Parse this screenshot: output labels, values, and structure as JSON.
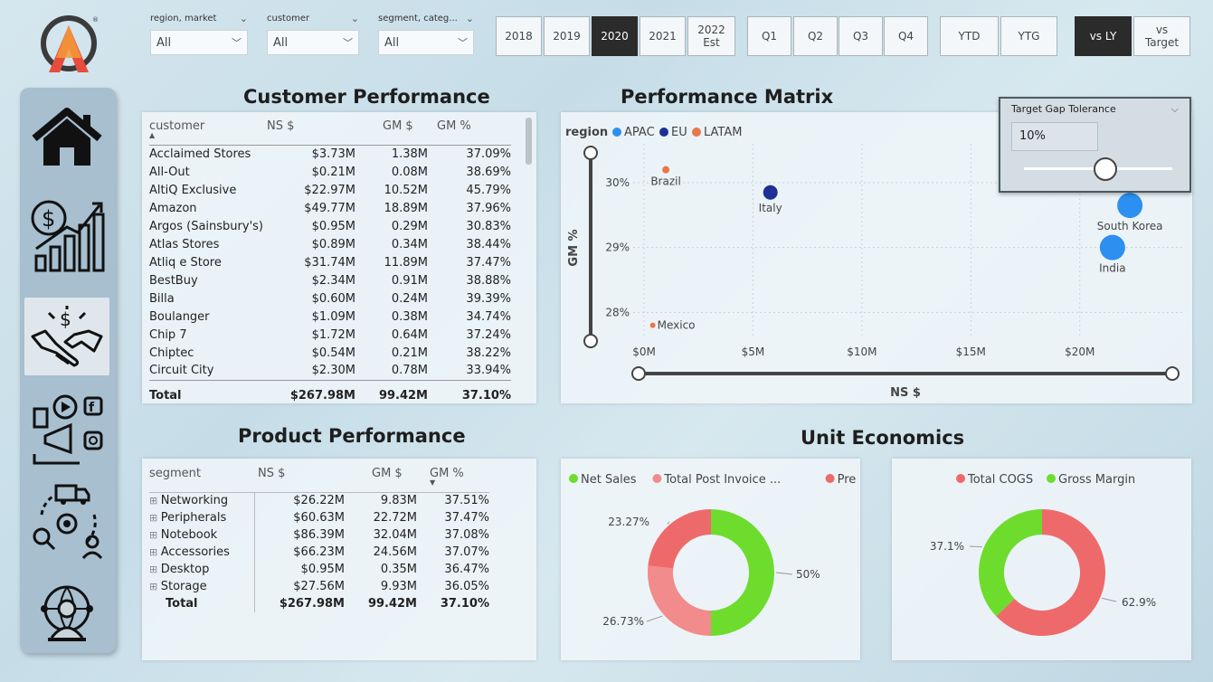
{
  "filters": {
    "region": {
      "label": "region, market",
      "value": "All"
    },
    "customer": {
      "label": "customer",
      "value": "All"
    },
    "segment": {
      "label": "segment, categ...",
      "value": "All"
    }
  },
  "years": [
    "2018",
    "2019",
    "2020",
    "2021",
    "2022 Est"
  ],
  "selected_year": "2020",
  "quarters": [
    "Q1",
    "Q2",
    "Q3",
    "Q4"
  ],
  "period": [
    "YTD",
    "YTG"
  ],
  "compare": [
    "vs LY",
    "vs Target"
  ],
  "selected_compare": "vs LY",
  "nav": [
    "home-icon",
    "finance-growth-icon",
    "sales-handshake-icon",
    "marketing-icon",
    "supply-chain-icon",
    "executive-icon"
  ],
  "customer_performance": {
    "title": "Customer Performance",
    "columns": [
      "customer",
      "NS $",
      "GM $",
      "GM %"
    ],
    "rows": [
      [
        "Acclaimed Stores",
        "$3.73M",
        "1.38M",
        "37.09%"
      ],
      [
        "All-Out",
        "$0.21M",
        "0.08M",
        "38.69%"
      ],
      [
        "AltiQ Exclusive",
        "$22.97M",
        "10.52M",
        "45.79%"
      ],
      [
        "Amazon",
        "$49.77M",
        "18.89M",
        "37.96%"
      ],
      [
        "Argos (Sainsbury's)",
        "$0.95M",
        "0.29M",
        "30.83%"
      ],
      [
        "Atlas Stores",
        "$0.89M",
        "0.34M",
        "38.44%"
      ],
      [
        "Atliq e Store",
        "$31.74M",
        "11.89M",
        "37.47%"
      ],
      [
        "BestBuy",
        "$2.34M",
        "0.91M",
        "38.88%"
      ],
      [
        "Billa",
        "$0.60M",
        "0.24M",
        "39.39%"
      ],
      [
        "Boulanger",
        "$1.09M",
        "0.38M",
        "34.74%"
      ],
      [
        "Chip 7",
        "$1.72M",
        "0.64M",
        "37.24%"
      ],
      [
        "Chiptec",
        "$0.54M",
        "0.21M",
        "38.22%"
      ],
      [
        "Circuit City",
        "$2.30M",
        "0.78M",
        "33.94%"
      ]
    ],
    "total": [
      "Total",
      "$267.98M",
      "99.42M",
      "37.10%"
    ]
  },
  "performance_matrix": {
    "title": "Performance Matrix",
    "legend_title": "region",
    "legend": [
      {
        "name": "APAC",
        "color": "#2d8ff0"
      },
      {
        "name": "EU",
        "color": "#1f2f96"
      },
      {
        "name": "LATAM",
        "color": "#e8764a"
      }
    ],
    "ylabel": "GM %",
    "xlabel": "NS $",
    "yticks": [
      "30%",
      "29%",
      "28%"
    ],
    "xticks": [
      "$0M",
      "$5M",
      "$10M",
      "$15M",
      "$20M"
    ]
  },
  "chart_data": [
    {
      "type": "scatter",
      "title": "Performance Matrix",
      "xlabel": "NS $",
      "ylabel": "GM %",
      "xlim": [
        0,
        23
      ],
      "ylim": [
        27.6,
        30.6
      ],
      "series": [
        {
          "name": "APAC",
          "color": "#2d8ff0",
          "points": [
            {
              "label": "South Korea",
              "x": 22.3,
              "y": 29.65,
              "size": 14
            },
            {
              "label": "India",
              "x": 21.5,
              "y": 29.0,
              "size": 14
            }
          ]
        },
        {
          "name": "EU",
          "color": "#1f2f96",
          "points": [
            {
              "label": "Italy",
              "x": 5.8,
              "y": 29.85,
              "size": 8
            }
          ]
        },
        {
          "name": "LATAM",
          "color": "#e8764a",
          "points": [
            {
              "label": "Brazil",
              "x": 1.0,
              "y": 30.2,
              "size": 4
            },
            {
              "label": "Mexico",
              "x": 0.4,
              "y": 27.8,
              "size": 3
            }
          ]
        }
      ]
    },
    {
      "type": "pie",
      "title": "Unit Economics",
      "legend": [
        "Net Sales",
        "Total Post Invoice ...",
        "Pre Invoice ..."
      ],
      "slices": [
        {
          "name": "Net Sales",
          "value": 50,
          "label": "50%",
          "color": "#6ddc2d"
        },
        {
          "name": "Total Post Invoice Deduction",
          "value": 26.73,
          "label": "26.73%",
          "color": "#f28b8b"
        },
        {
          "name": "Pre Invoice Deduction",
          "value": 23.27,
          "label": "23.27%",
          "color": "#ee6a6a"
        }
      ]
    },
    {
      "type": "pie",
      "legend": [
        "Total COGS",
        "Gross Margin"
      ],
      "slices": [
        {
          "name": "Total COGS",
          "value": 62.9,
          "label": "62.9%",
          "color": "#ee6a6a"
        },
        {
          "name": "Gross Margin",
          "value": 37.1,
          "label": "37.1%",
          "color": "#6ddc2d"
        }
      ]
    }
  ],
  "target_gap": {
    "title": "Target Gap Tolerance",
    "value": "10%",
    "fraction": 0.55
  },
  "product_performance": {
    "title": "Product Performance",
    "columns": [
      "segment",
      "NS $",
      "GM $",
      "GM %"
    ],
    "rows": [
      [
        "Networking",
        "$26.22M",
        "9.83M",
        "37.51%"
      ],
      [
        "Peripherals",
        "$60.63M",
        "22.72M",
        "37.47%"
      ],
      [
        "Notebook",
        "$86.39M",
        "32.04M",
        "37.08%"
      ],
      [
        "Accessories",
        "$66.23M",
        "24.56M",
        "37.07%"
      ],
      [
        "Desktop",
        "$0.95M",
        "0.35M",
        "36.47%"
      ],
      [
        "Storage",
        "$27.56M",
        "9.93M",
        "36.05%"
      ]
    ],
    "total": [
      "Total",
      "$267.98M",
      "99.42M",
      "37.10%"
    ]
  },
  "unit_economics": {
    "title": "Unit Economics",
    "donut1_legend": [
      {
        "name": "Net Sales",
        "color": "#6ddc2d"
      },
      {
        "name": "Total Post Invoice ...",
        "color": "#f28b8b"
      },
      {
        "name": "Pre Invoice ...",
        "color": "#ee6a6a"
      }
    ],
    "donut2_legend": [
      {
        "name": "Total COGS",
        "color": "#ee6a6a"
      },
      {
        "name": "Gross Margin",
        "color": "#6ddc2d"
      }
    ]
  }
}
